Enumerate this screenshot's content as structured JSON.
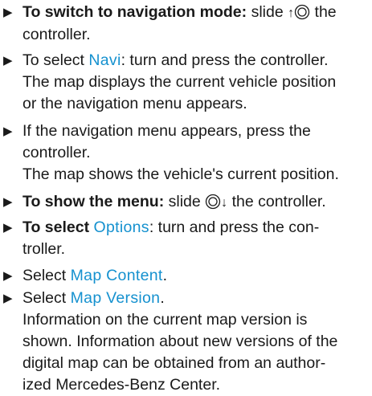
{
  "bullet_glyph": "▶",
  "steps": [
    {
      "lead": "To switch to navigation mode:",
      "text_a": " slide ",
      "arrow": "↑",
      "text_b": " the",
      "line2": "controller."
    },
    {
      "text_a": "To select ",
      "mono": "Navi",
      "text_b": ": turn and press the controller.",
      "line2": "The map displays the current vehicle position",
      "line3": "or the navigation menu appears."
    },
    {
      "line1": "If the navigation menu appears, press the",
      "line2": "controller.",
      "line3": "The map shows the vehicle's current position."
    },
    {
      "lead": "To show the menu:",
      "text_a": " slide ",
      "arrow": "↓",
      "text_b": " the controller."
    },
    {
      "lead": "To select ",
      "mono": "Options",
      "text_b": ": turn and press the con-",
      "line2": "troller."
    },
    {
      "text_a": "Select ",
      "mono": "Map Content",
      "text_b": "."
    },
    {
      "text_a": "Select ",
      "mono": "Map Version",
      "text_b": ".",
      "line2": "Information on the current map version is",
      "line3": "shown. Information about new versions of the",
      "line4": "digital map can be obtained from an author-",
      "line5": "ized Mercedes-Benz Center."
    }
  ],
  "icons": {
    "controller": "controller-knob-icon"
  },
  "colors": {
    "accent": "#1591cf",
    "text": "#1a1a1a"
  }
}
